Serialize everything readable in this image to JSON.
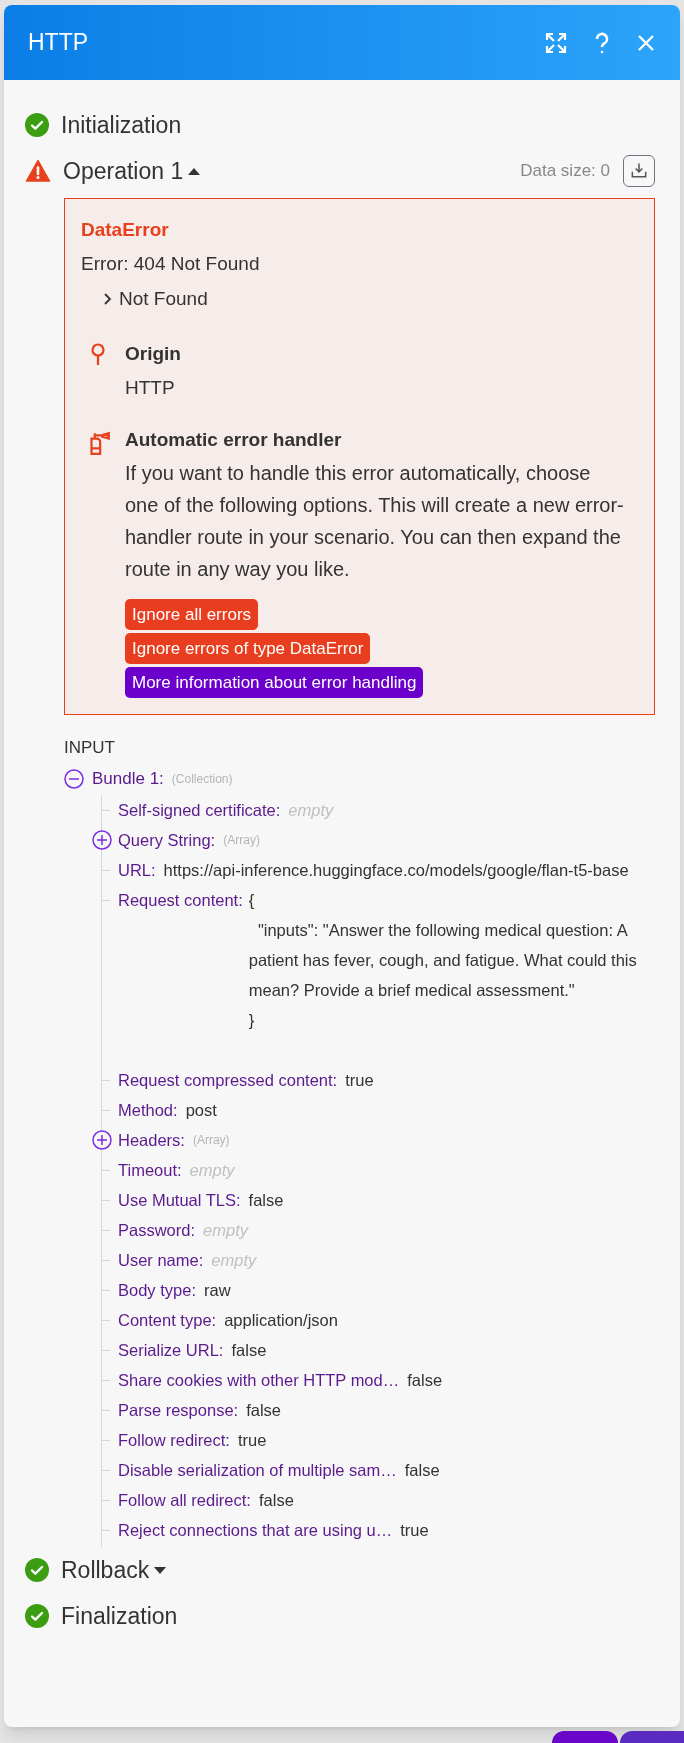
{
  "window": {
    "title": "HTTP"
  },
  "steps": [
    {
      "label": "Initialization",
      "failed": false
    },
    {
      "label": "Operation 1",
      "failed": true,
      "expanded": true,
      "data_size": "Data size: 0",
      "error": {
        "title": "DataError",
        "message": "Error: 404 Not Found",
        "detail": "Not Found",
        "detail_expanded": false,
        "origin": {
          "heading": "Origin",
          "value": "HTTP"
        },
        "handler": {
          "heading": "Automatic error handler",
          "text": "If you want to handle this error automatically, choose one of the following options. This will create a new error-handler route in your scenario. You can then expand the route in any way you like.",
          "buttons": [
            {
              "label": "Ignore all errors",
              "kind": "danger"
            },
            {
              "label": "Ignore errors of type DataError",
              "kind": "danger"
            },
            {
              "label": "More information about error handling",
              "kind": "info"
            }
          ]
        }
      },
      "input": {
        "heading": "INPUT",
        "bundle": {
          "label": "Bundle 1:",
          "type": "(Collection)",
          "expanded": true,
          "items": [
            {
              "kind": "empty",
              "label": "Self-signed certificate:",
              "value": "empty"
            },
            {
              "kind": "array",
              "label": "Query String:",
              "type": "(Array)",
              "expanded": false
            },
            {
              "kind": "field",
              "label": "URL:",
              "value": "https://api-inference.huggingface.co/models/google/flan-t5-base"
            },
            {
              "kind": "block",
              "label": "Request content:",
              "value": "{\n  \"inputs\": \"Answer the following medical question: A patient has fever, cough, and fatigue. What could this mean? Provide a brief medical assessment.\"\n}"
            },
            {
              "kind": "field",
              "label": "Request compressed content:",
              "value": "true"
            },
            {
              "kind": "field",
              "label": "Method:",
              "value": "post"
            },
            {
              "kind": "array",
              "label": "Headers:",
              "type": "(Array)",
              "expanded": false
            },
            {
              "kind": "empty",
              "label": "Timeout:",
              "value": "empty"
            },
            {
              "kind": "field",
              "label": "Use Mutual TLS:",
              "value": "false"
            },
            {
              "kind": "empty",
              "label": "Password:",
              "value": "empty"
            },
            {
              "kind": "empty",
              "label": "User name:",
              "value": "empty"
            },
            {
              "kind": "field",
              "label": "Body type:",
              "value": "raw"
            },
            {
              "kind": "field",
              "label": "Content type:",
              "value": "application/json"
            },
            {
              "kind": "field",
              "label": "Serialize URL:",
              "value": "false"
            },
            {
              "kind": "field",
              "label": "Share cookies with other HTTP mod…",
              "value": "false"
            },
            {
              "kind": "field",
              "label": "Parse response:",
              "value": "false"
            },
            {
              "kind": "field",
              "label": "Follow redirect:",
              "value": "true"
            },
            {
              "kind": "field",
              "label": "Disable serialization of multiple sam…",
              "value": "false"
            },
            {
              "kind": "field",
              "label": "Follow all redirect:",
              "value": "false"
            },
            {
              "kind": "field",
              "label": "Reject connections that are using u…",
              "value": "true"
            }
          ]
        }
      }
    },
    {
      "label": "Rollback",
      "failed": false,
      "expanded": false
    },
    {
      "label": "Finalization",
      "failed": false
    }
  ]
}
